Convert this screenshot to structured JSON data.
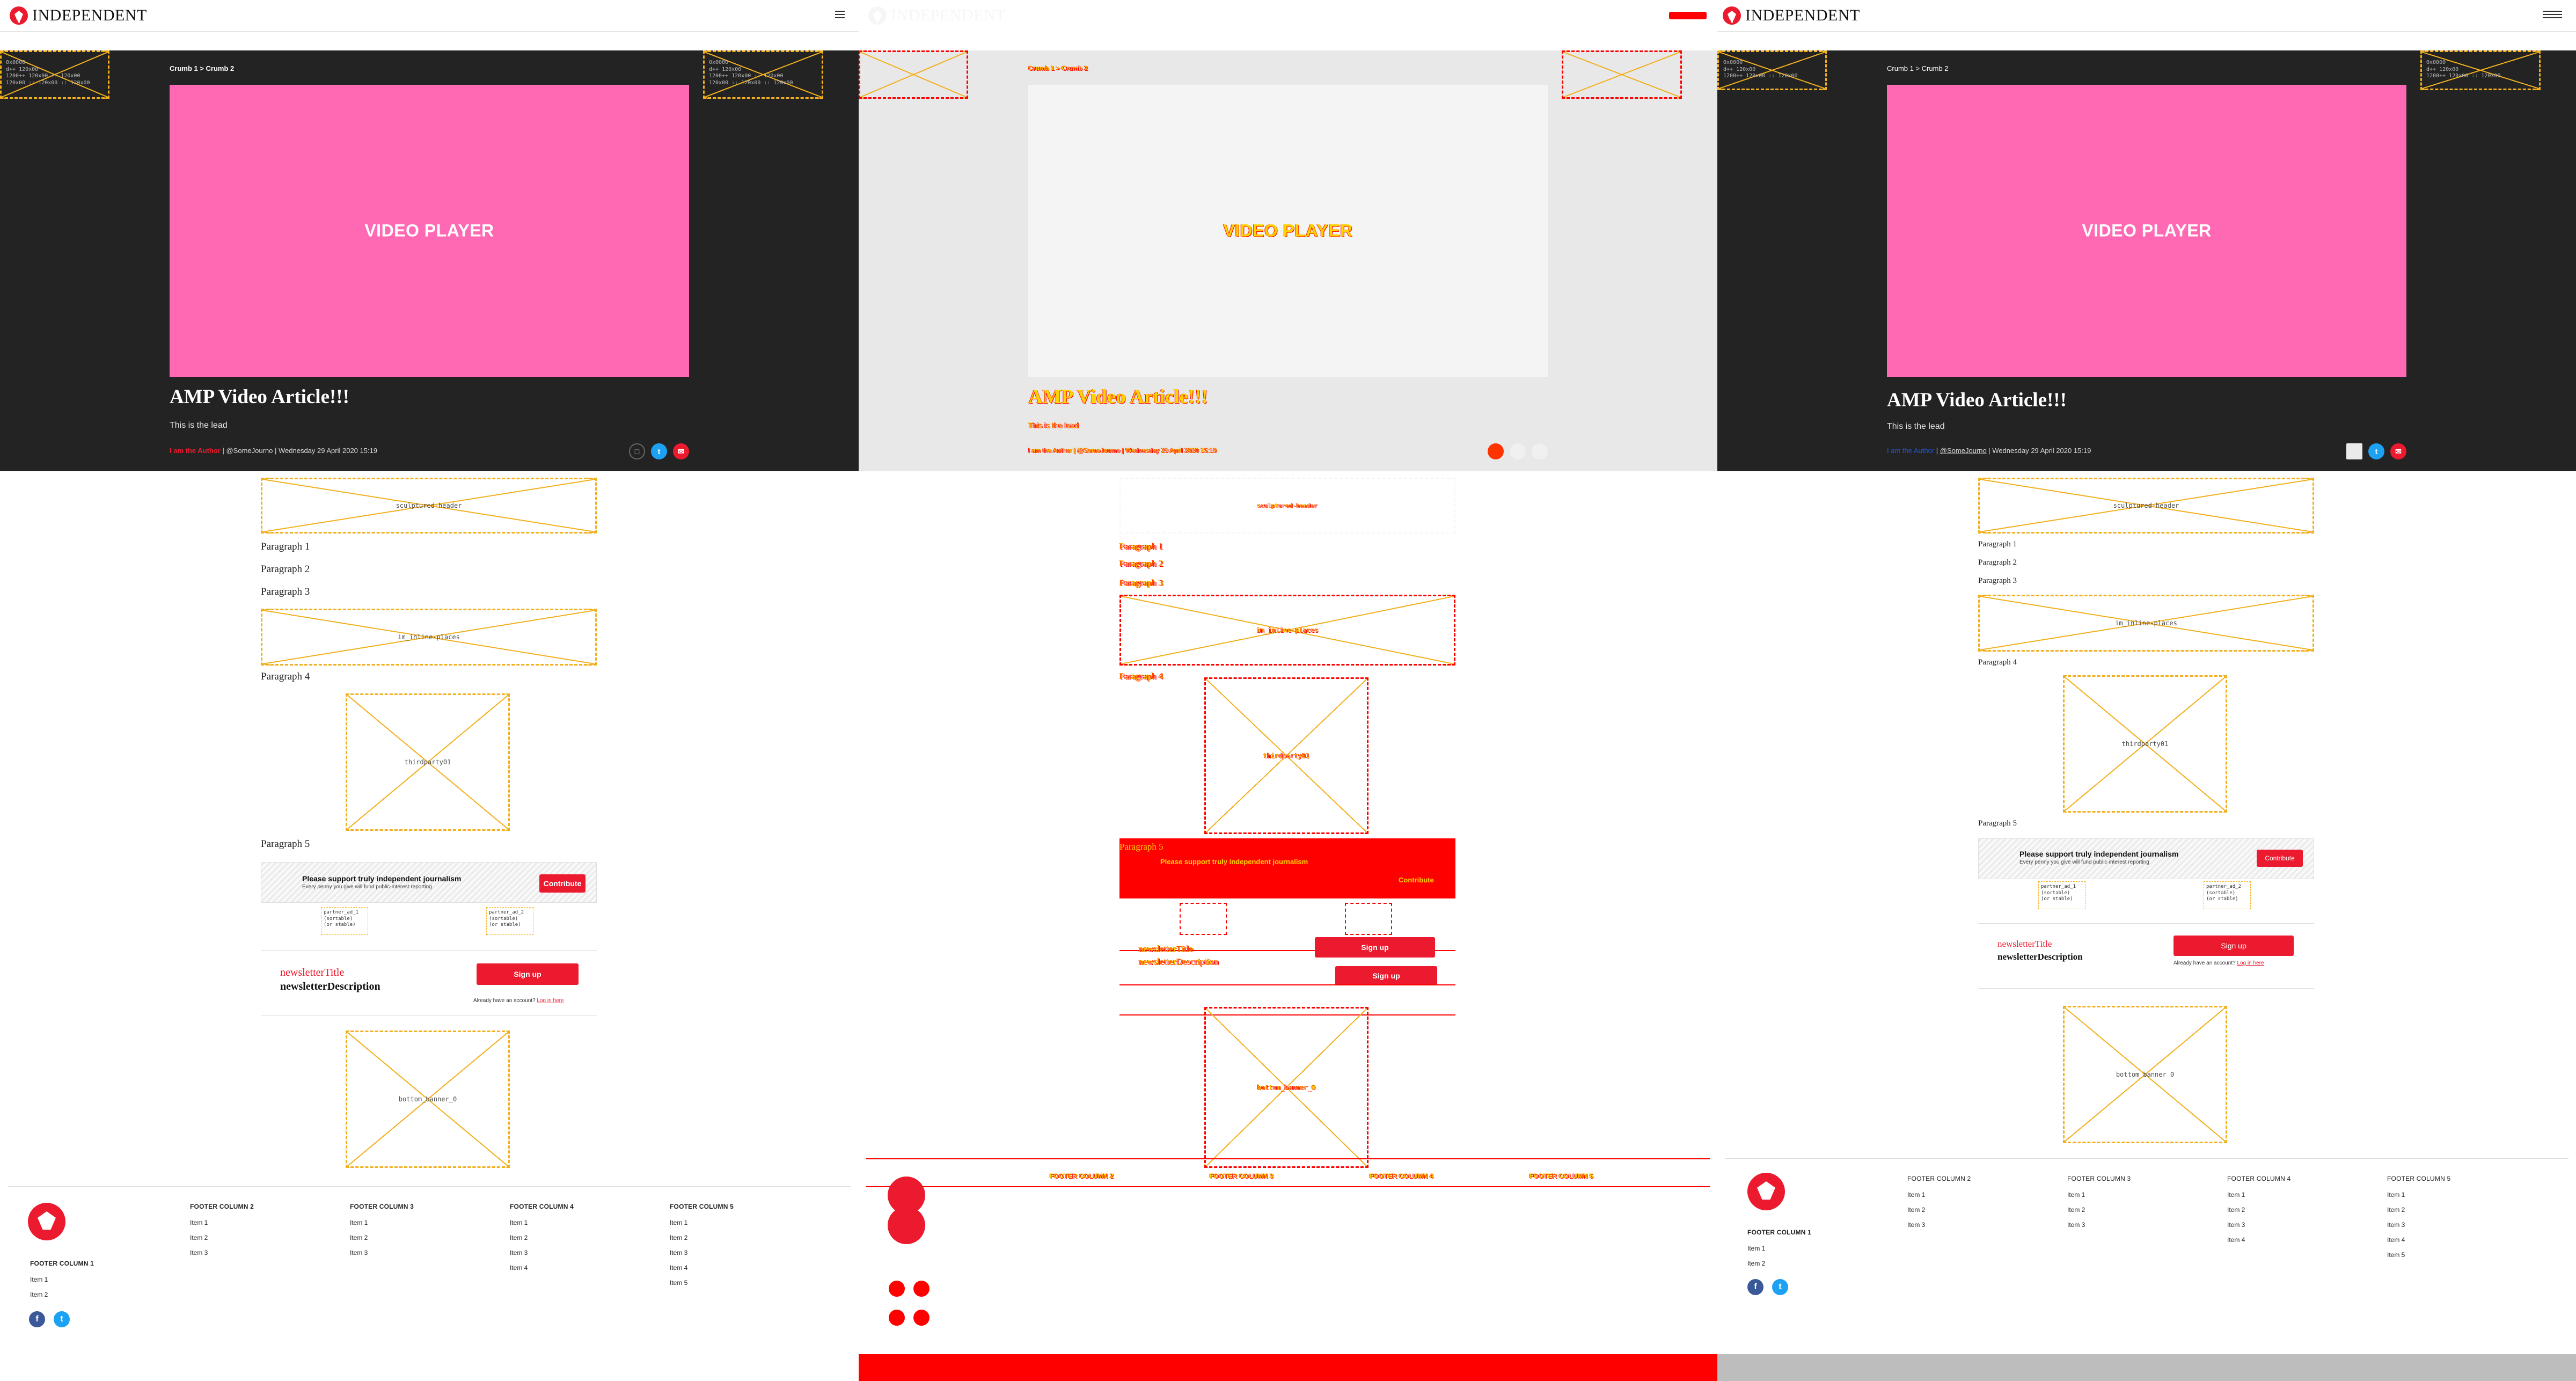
{
  "brand": {
    "name": "INDEPENDENT",
    "accent": "#ec1a2e",
    "pink": "#ff69b4"
  },
  "header": {
    "menu_icon": "hamburger-icon"
  },
  "hero": {
    "ad_top_left": [
      "0x0000",
      "d++ 120x00",
      "1200++ 120x00 :: 120x00",
      "120x00 :: 120x00 :: 120x00"
    ],
    "ad_top_right": [
      "0x0000",
      "d++ 120x00",
      "1200++ 120x00 :: 120x00",
      "120x00 :: 120x00 :: 120x00"
    ],
    "ad_top_label": "gkl",
    "breadcrumb": "Crumb 1 > Crumb 2",
    "video_label": "VIDEO PLAYER",
    "title": "AMP Video Article!!!",
    "lead": "This is the lead",
    "author": "I am the Author",
    "handle": "@SomeJourno",
    "date": "Wednesday 29 April 2020 15:19",
    "separator": " | "
  },
  "body": {
    "ad_header": "sculptured-header",
    "paragraphs": [
      "Paragraph 1",
      "Paragraph 2",
      "Paragraph 3",
      "Paragraph 4",
      "Paragraph 5"
    ],
    "ad_inline": "im_inline-places",
    "thirdparty": "thirdparty01",
    "support": {
      "title": "Please support truly independent journalism",
      "subtitle": "Every penny you give will fund public-interest reporting",
      "button": "Contribute"
    },
    "partners": [
      {
        "name": "partner_ad_1",
        "l1": "(sortable)",
        "l2": "(or stable)"
      },
      {
        "name": "partner_ad_2",
        "l1": "(sortable)",
        "l2": "(or stable)"
      }
    ],
    "newsletter": {
      "title": "newsletterTitle",
      "description": "newsletterDescription",
      "button": "Sign up",
      "hint": "Already have an account?",
      "login": "Log in here"
    },
    "bottom_banner": "bottom_banner_0"
  },
  "footer": {
    "columns": [
      {
        "heading": "FOOTER COLUMN 1",
        "items": [
          "Item 1",
          "Item 2"
        ]
      },
      {
        "heading": "FOOTER COLUMN 2",
        "items": [
          "Item 1",
          "Item 2",
          "Item 3"
        ]
      },
      {
        "heading": "FOOTER COLUMN 3",
        "items": [
          "Item 1",
          "Item 2",
          "Item 3"
        ]
      },
      {
        "heading": "FOOTER COLUMN 4",
        "items": [
          "Item 1",
          "Item 2",
          "Item 3",
          "Item 4"
        ]
      },
      {
        "heading": "FOOTER COLUMN 5",
        "items": [
          "Item 1",
          "Item 2",
          "Item 3",
          "Item 4",
          "Item 5"
        ]
      }
    ],
    "social": [
      "facebook-icon",
      "twitter-icon"
    ]
  },
  "panels": {
    "debug_bar_color": "#ff0000",
    "third_bar_color": "#bdbdbd"
  }
}
